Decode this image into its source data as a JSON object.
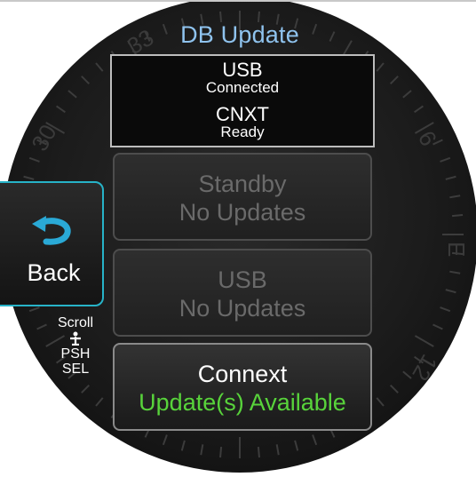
{
  "title": "DB Update",
  "status": {
    "usb_label": "USB",
    "usb_state": "Connected",
    "cnxt_label": "CNXT",
    "cnxt_state": "Ready"
  },
  "options": [
    {
      "name": "Standby",
      "status": "No Updates",
      "enabled": false
    },
    {
      "name": "USB",
      "status": "No Updates",
      "enabled": false
    },
    {
      "name": "Connext",
      "status": "Update(s) Available",
      "enabled": true
    }
  ],
  "back_label": "Back",
  "knob_hint": {
    "scroll": "Scroll",
    "push": "PSH",
    "select": "SEL"
  },
  "compass_labels": [
    "33",
    "30",
    "6",
    "E",
    "12"
  ],
  "colors": {
    "title": "#8fc3ee",
    "available": "#58d33b",
    "back_border": "#27b3c8",
    "disabled_text": "#6a6a6a"
  }
}
